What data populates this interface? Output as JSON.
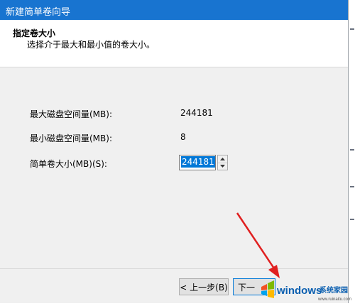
{
  "window": {
    "title": "新建简单卷向导"
  },
  "header": {
    "heading": "指定卷大小",
    "subheading": "选择介于最大和最小值的卷大小。"
  },
  "fields": {
    "max_label": "最大磁盘空间量(MB):",
    "max_value": "244181",
    "min_label": "最小磁盘空间量(MB):",
    "min_value": "8",
    "size_label": "简单卷大小(MB)(S):",
    "size_value": "244181"
  },
  "buttons": {
    "back_label": "< 上一步(B)",
    "next_label": "下一"
  },
  "watermark": {
    "brand_text": "windows",
    "brand_suffix": "系统家园",
    "url_text": "www.ruinaitu.com"
  },
  "colors": {
    "titlebar": "#1874d0",
    "dialog_bg": "#f0f0f0",
    "selection": "#0078d7",
    "annotation_arrow": "#e02020"
  },
  "icons": {
    "spin_up": "chevron-up-icon",
    "spin_down": "chevron-down-icon",
    "watermark_logo": "windows-logo-icon"
  }
}
